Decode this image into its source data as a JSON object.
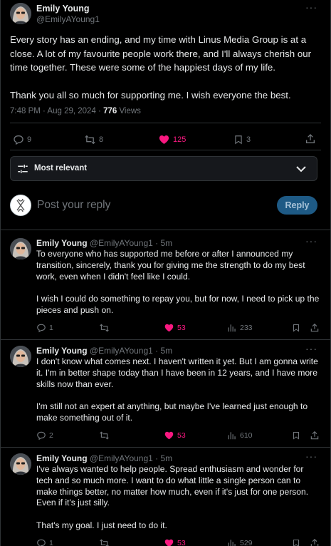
{
  "colors": {
    "background": "#000000",
    "text": "#e7e9ea",
    "muted": "#71767b",
    "like": "#f91880",
    "reply_button": "#1e5a85",
    "border": "#2f3336"
  },
  "tweet": {
    "author_name": "Emily Young",
    "author_handle": "@EmilyAYoung1",
    "more_icon": "ellipsis-icon",
    "paragraphs": [
      "Every story has an ending, and my time with Linus Media Group is at a close. A lot of my favourite people work there, and I'll always cherish our time together. These were some of the happiest days of my life.",
      "Thank you all so much for supporting me. I wish everyone the best."
    ],
    "timestamp": "7:48 PM · Aug 29, 2024 · ",
    "views_count": "776",
    "views_label": " Views",
    "stats": {
      "replies": "9",
      "reposts": "8",
      "likes": "125",
      "bookmarks": "3"
    }
  },
  "sort": {
    "label": "Most relevant",
    "icon": "sliders-icon",
    "chevron": "chevron-down-icon"
  },
  "composer": {
    "placeholder": "Post your reply",
    "button_label": "Reply"
  },
  "replies": [
    {
      "name": "Emily Young",
      "handle": "@EmilyAYoung1 · 5m",
      "paragraphs": [
        "To everyone who has supported me before or after I announced my transition, sincerely, thank you for giving me the strength to do my best work, even when I didn't feel like I could.",
        "I wish I could do something to repay you, but for now, I need to pick up the pieces and push on."
      ],
      "stats": {
        "replies": "1",
        "reposts": "",
        "likes": "53",
        "views": "233"
      }
    },
    {
      "name": "Emily Young",
      "handle": "@EmilyAYoung1 · 5m",
      "paragraphs": [
        "I don't know what comes next. I haven't written it yet. But I am gonna write it. I'm in better shape today than I have been in 12 years, and I have more skills now than ever.",
        "I'm still not an expert at anything, but maybe I've learned just enough to make something out of it."
      ],
      "stats": {
        "replies": "2",
        "reposts": "",
        "likes": "53",
        "views": "610"
      }
    },
    {
      "name": "Emily Young",
      "handle": "@EmilyAYoung1 · 5m",
      "paragraphs": [
        "I've always wanted to help people. Spread enthusiasm and wonder for tech and so much more. I want to do what little a single person can to make things better, no matter how much, even if it's just for one person. Even if it's just silly.",
        "That's my goal. I just need to do it."
      ],
      "stats": {
        "replies": "1",
        "reposts": "",
        "likes": "53",
        "views": "529"
      }
    }
  ]
}
